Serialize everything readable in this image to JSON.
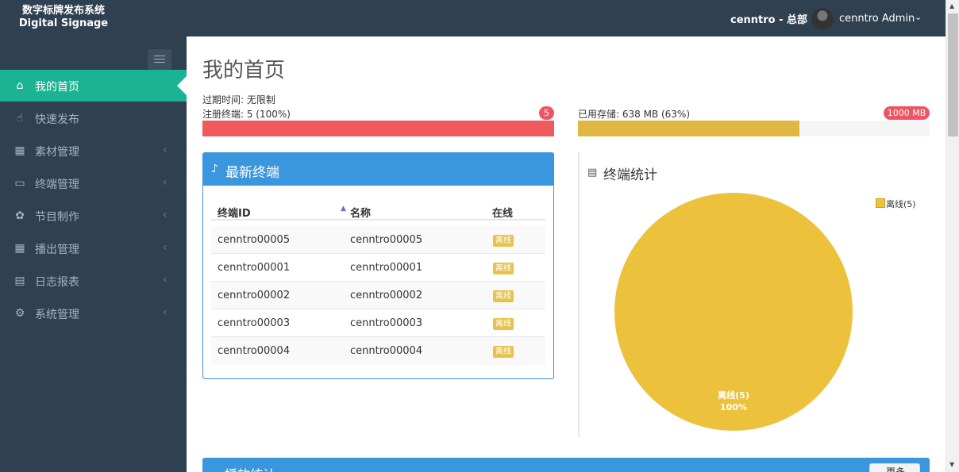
{
  "brand": {
    "title_cn": "数字标牌发布系统",
    "title_en": "Digital Signage"
  },
  "header": {
    "org": "cenntro - 总部",
    "user": "cenntro Admin"
  },
  "sidebar": {
    "items": [
      {
        "label": "我的首页",
        "icon": "home-icon",
        "active": true
      },
      {
        "label": "快速发布",
        "icon": "hand-pointer-icon"
      },
      {
        "label": "素材管理",
        "icon": "qrcode-icon"
      },
      {
        "label": "终端管理",
        "icon": "desktop-icon"
      },
      {
        "label": "节目制作",
        "icon": "paw-icon"
      },
      {
        "label": "播出管理",
        "icon": "calendar-icon"
      },
      {
        "label": "日志报表",
        "icon": "bar-chart-icon"
      },
      {
        "label": "系统管理",
        "icon": "gears-icon"
      }
    ]
  },
  "main": {
    "title": "我的首页",
    "expiry": "过期时间: 无限制",
    "registered_label": "注册终端: 5 (100%)",
    "registered_badge": "5",
    "registered_percent": 100,
    "storage_label": "已用存储: 638 MB (63%)",
    "storage_badge": "1000 MB",
    "storage_percent": 63
  },
  "terminals_panel": {
    "title": "最新终端",
    "columns": [
      "终端ID",
      "名称",
      "在线"
    ],
    "rows": [
      {
        "id": "cenntro00005",
        "name": "cenntro00005",
        "status": "离线"
      },
      {
        "id": "cenntro00001",
        "name": "cenntro00001",
        "status": "离线"
      },
      {
        "id": "cenntro00002",
        "name": "cenntro00002",
        "status": "离线"
      },
      {
        "id": "cenntro00003",
        "name": "cenntro00003",
        "status": "离线"
      },
      {
        "id": "cenntro00004",
        "name": "cenntro00004",
        "status": "离线"
      }
    ]
  },
  "stats_panel": {
    "title": "终端统计",
    "legend": "离线(5)",
    "slice_label": "离线(5)",
    "slice_percent": "100%"
  },
  "chart_data": {
    "type": "pie",
    "categories": [
      "离线"
    ],
    "values": [
      5
    ],
    "colors": [
      "#ecc23c"
    ]
  },
  "bottom_panel": {
    "title": "播放统计",
    "button": "更多"
  },
  "colors": {
    "sidebar": "#2f4050",
    "active": "#1ab394",
    "panel": "#3b97dd",
    "danger": "#ed5565",
    "warning": "#ecc23c"
  }
}
